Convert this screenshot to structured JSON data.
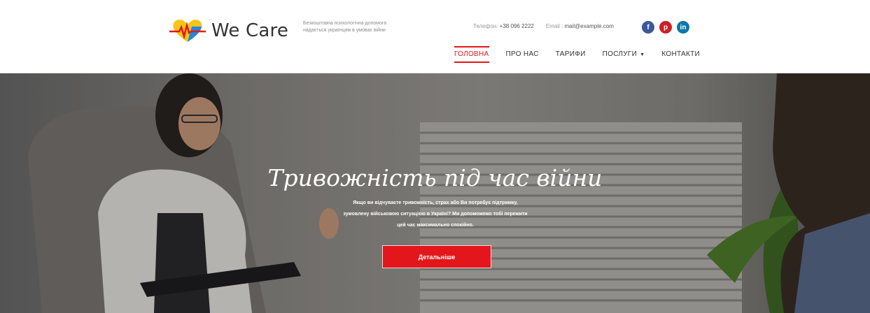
{
  "brand": {
    "name": "We Care",
    "tagline": "Безкоштовна психологічна допомога надається українцям в умовах війни",
    "logo_icon": "heart-pulse-icon"
  },
  "contacts": {
    "phone_label": "Телефон:",
    "phone": "+38 096 2222",
    "email_label": "Email :",
    "email": "mail@example.com"
  },
  "social": {
    "facebook": "f",
    "pinterest": "p",
    "linkedin": "in"
  },
  "nav": {
    "items": [
      {
        "label": "ГОЛОВНА"
      },
      {
        "label": "ПРО НАС"
      },
      {
        "label": "ТАРИФИ"
      },
      {
        "label": "ПОСЛУГИ"
      },
      {
        "label": "КОНТАКТИ"
      }
    ]
  },
  "hero": {
    "title": "Тривожність під час війни",
    "text": "Якщо ви відчуваєте тривожність, страх або Ви потребує підтримку, зумовлену військовою ситуацією в Україні? Ми допоможемо тобі пережити цей час максимально спокійно.",
    "button_label": "Детальніше"
  },
  "colors": {
    "accent": "#e3171b",
    "facebook": "#3b5998",
    "pinterest": "#cb2027",
    "linkedin": "#0e76a8"
  }
}
